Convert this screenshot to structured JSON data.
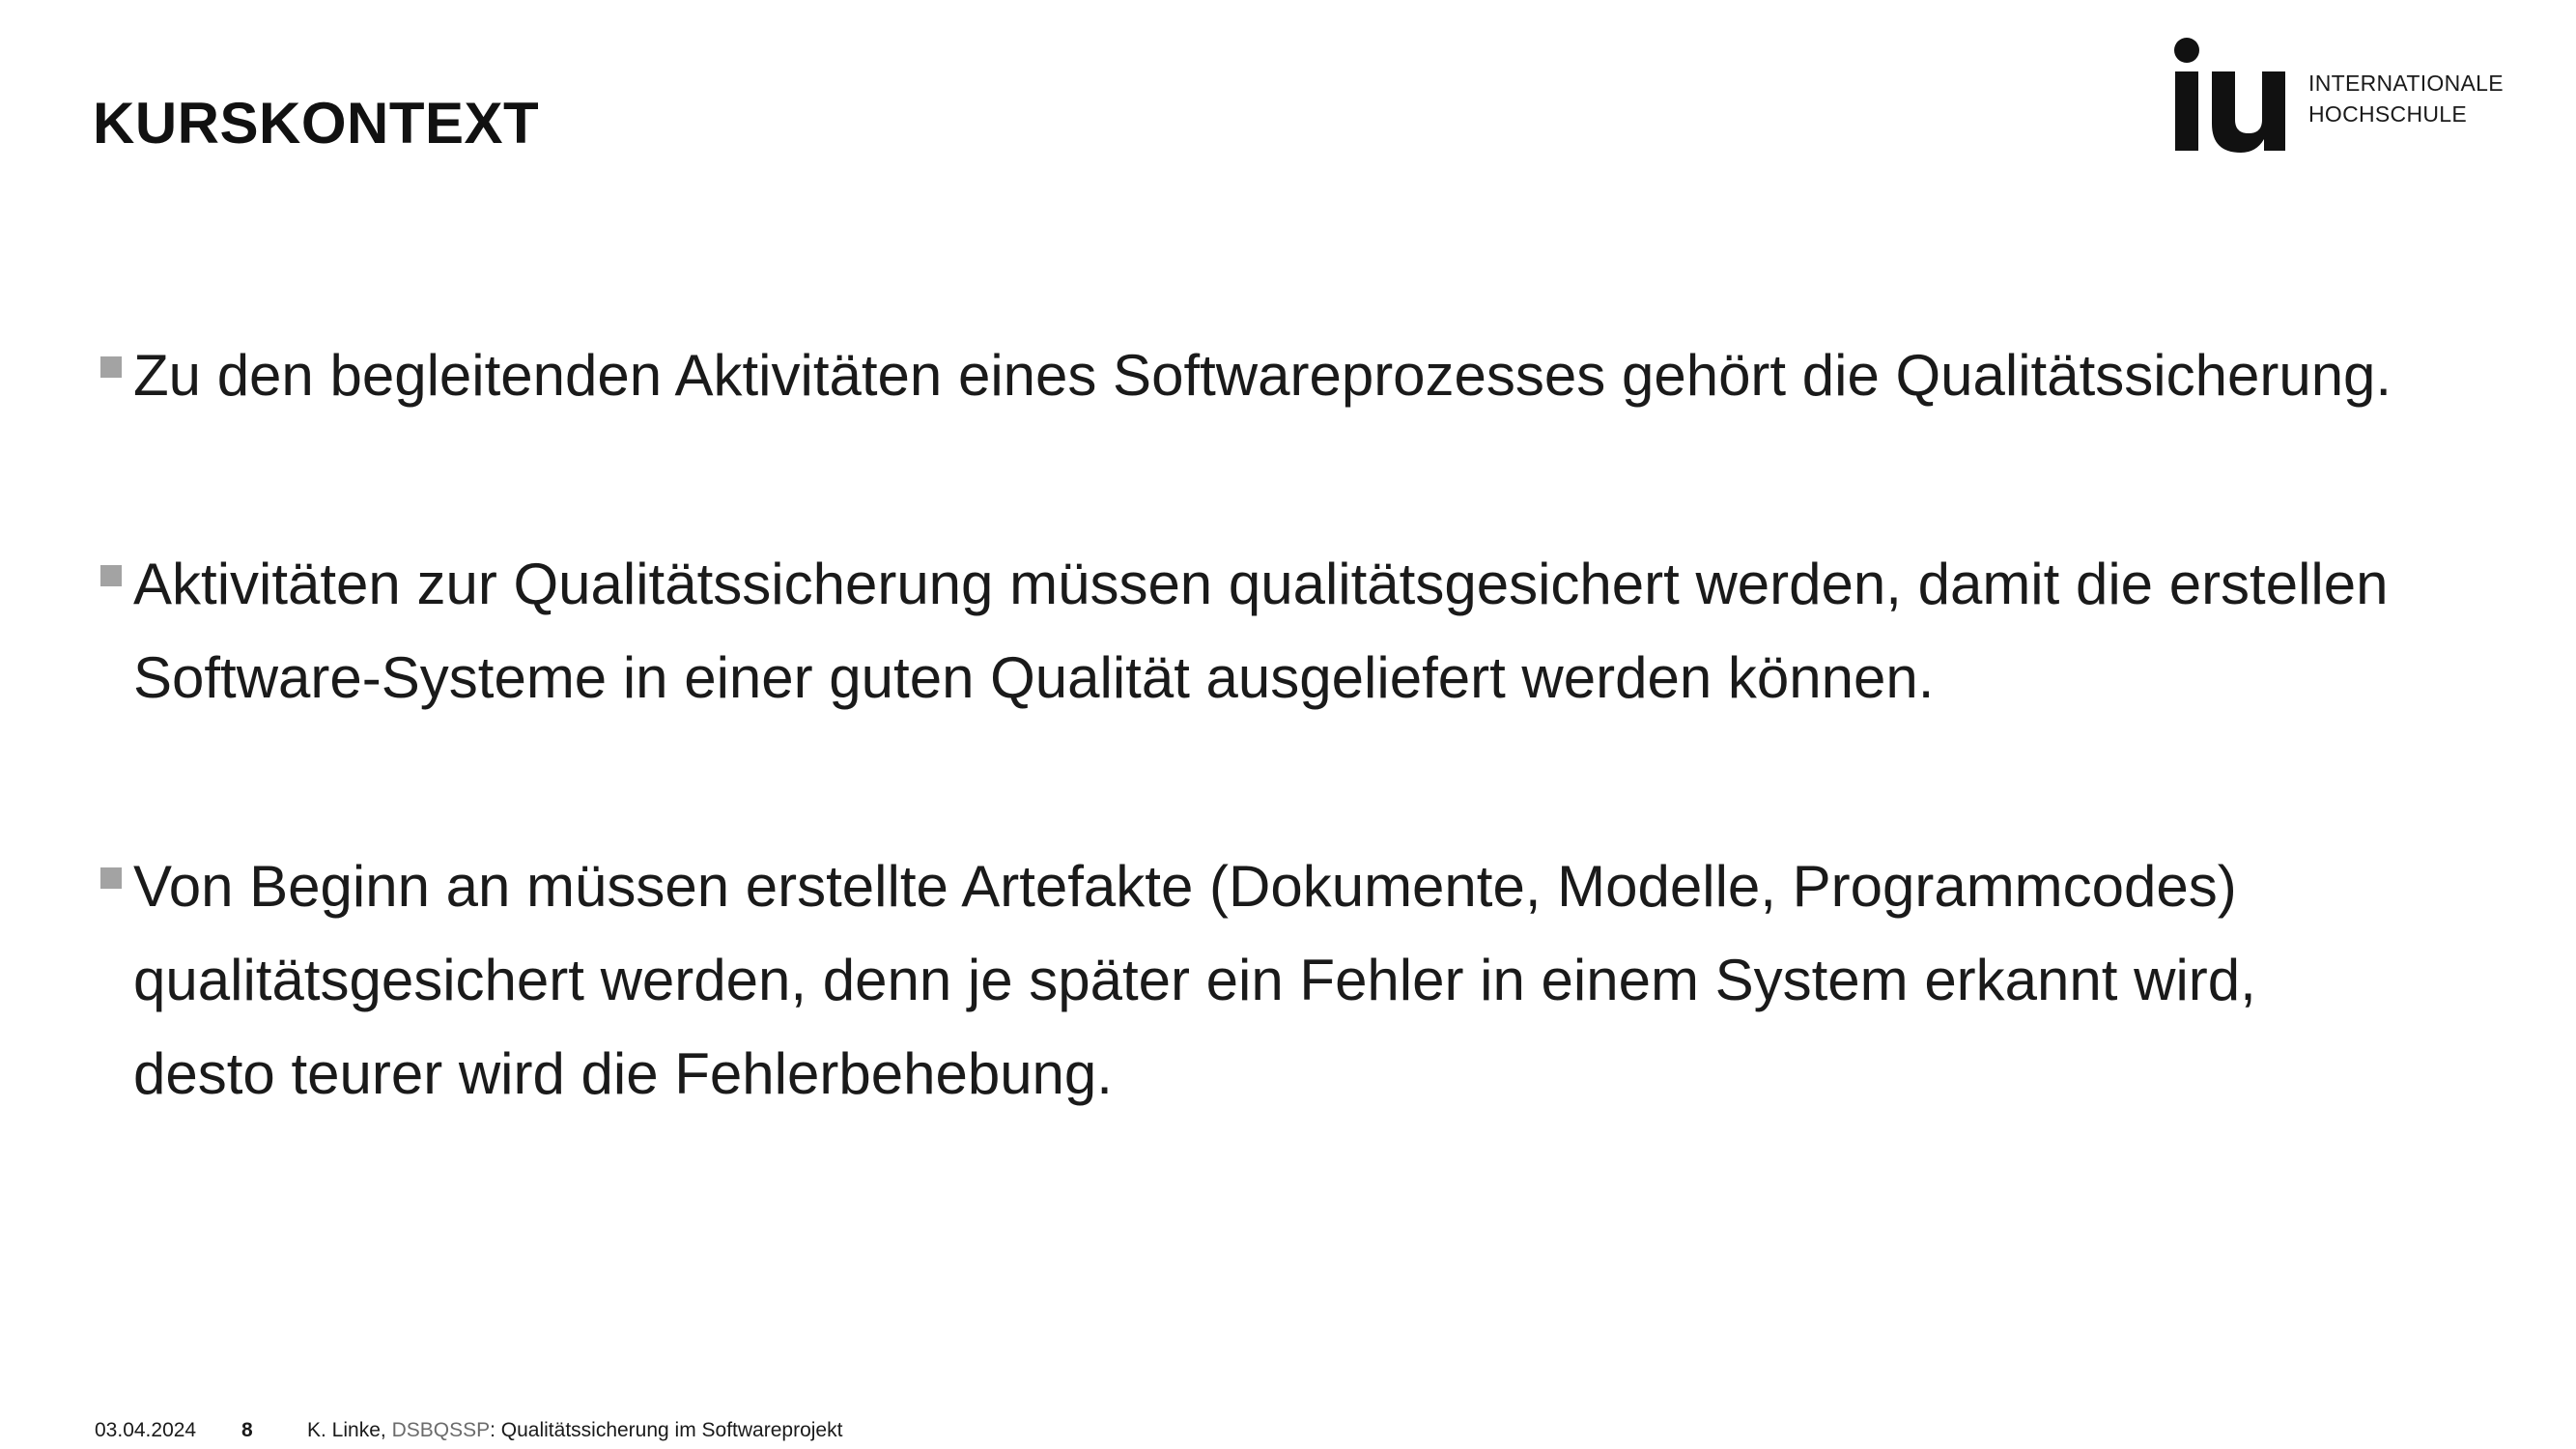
{
  "header": {
    "title": "KURSKONTEXT"
  },
  "logo": {
    "line1": "INTERNATIONALE",
    "line2": "HOCHSCHULE"
  },
  "bullets": [
    {
      "text": "Zu den begleitenden Aktivitäten eines Softwareprozesses gehört die Qualitätssicherung."
    },
    {
      "text": "Aktivitäten zur Qualitätssicherung müssen qualitätsgesichert werden, damit die erstellen Software-Systeme in einer guten Qualität ausgeliefert werden können."
    },
    {
      "text": "Von Beginn an müssen erstellte Artefakte (Dokumente, Modelle, Programmcodes) qualitätsgesichert werden, denn je später ein Fehler in einem System erkannt wird, desto teurer wird die Fehlerbehebung."
    }
  ],
  "footer": {
    "date": "03.04.2024",
    "page": "8",
    "author": "K. Linke, ",
    "course": "DSBQSSP",
    "subject": ": Qualitätssicherung im Softwareprojekt"
  },
  "colors": {
    "bullet_marker": "#a3a3a3",
    "text": "#1a1a1a",
    "course_code": "#6b6b6b"
  }
}
